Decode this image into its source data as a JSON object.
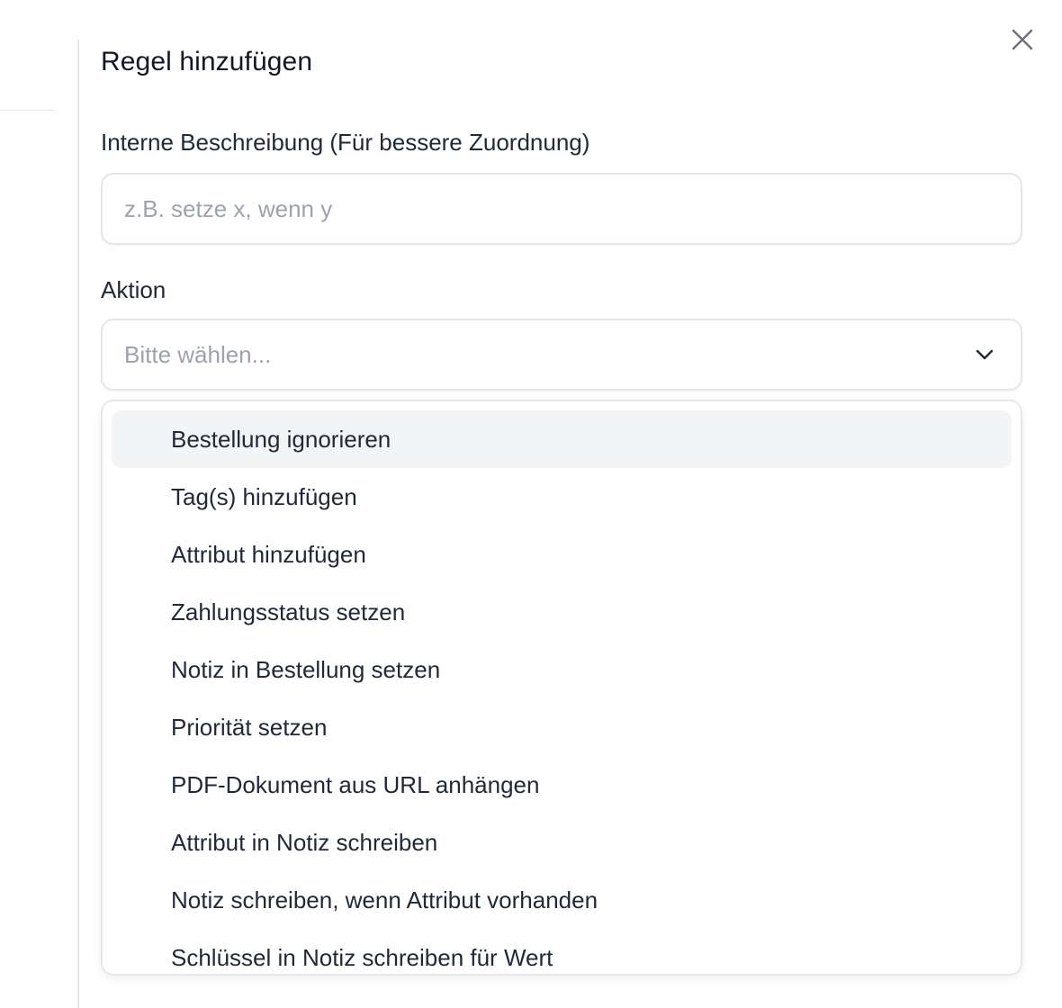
{
  "panel": {
    "title": "Regel hinzufügen",
    "close_icon": "close-icon"
  },
  "description_field": {
    "label": "Interne Beschreibung (Für bessere Zuordnung)",
    "value": "",
    "placeholder": "z.B. setze x, wenn y"
  },
  "action_field": {
    "label": "Aktion",
    "placeholder": "Bitte wählen...",
    "chevron_icon": "chevron-down-icon",
    "options": [
      {
        "label": "Bestellung ignorieren",
        "highlighted": true
      },
      {
        "label": "Tag(s) hinzufügen"
      },
      {
        "label": "Attribut hinzufügen"
      },
      {
        "label": "Zahlungsstatus setzen"
      },
      {
        "label": "Notiz in Bestellung setzen"
      },
      {
        "label": "Priorität setzen"
      },
      {
        "label": "PDF-Dokument aus URL anhängen"
      },
      {
        "label": "Attribut in Notiz schreiben"
      },
      {
        "label": "Notiz schreiben, wenn Attribut vorhanden"
      },
      {
        "label": "Schlüssel in Notiz schreiben für Wert"
      }
    ]
  },
  "colors": {
    "text": "#1f2937",
    "placeholder": "#9ca3af",
    "border": "#e5e7eb",
    "highlight": "#f3f4f6"
  }
}
